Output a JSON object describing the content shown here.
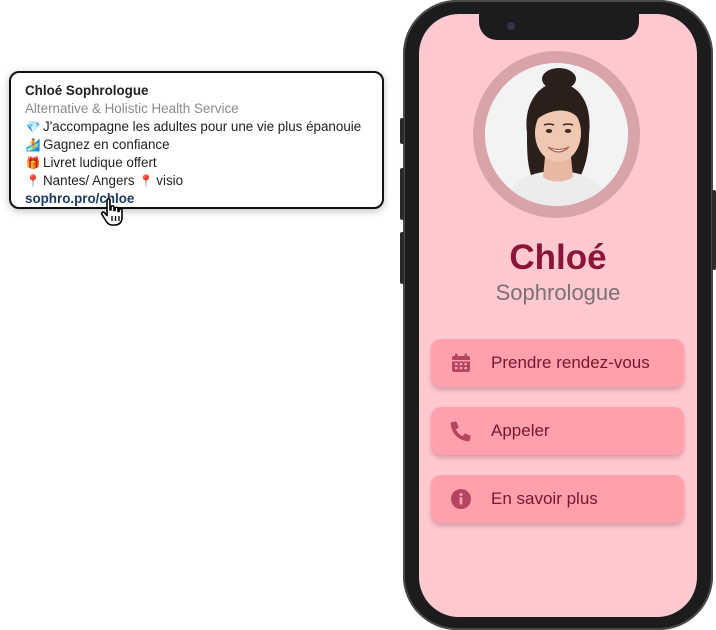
{
  "bio": {
    "name": "Chloé Sophrologue",
    "category": "Alternative & Holistic Health Service",
    "lines": [
      {
        "icon": "gem-icon",
        "emoji": "💎",
        "text": "J'accompagne les adultes pour une vie plus épanouie"
      },
      {
        "icon": "skier-icon",
        "emoji": "🏄",
        "text": "Gagnez en confiance"
      },
      {
        "icon": "gift-icon",
        "emoji": "🎁",
        "text": "Livret ludique offert"
      },
      {
        "icon": "pin-icon",
        "emoji": "📍",
        "text_before": "Nantes/ Angers",
        "text_after": "visio"
      }
    ],
    "link": "sophro.pro/chloe"
  },
  "profile": {
    "name": "Chloé",
    "title": "Sophrologue"
  },
  "actions": [
    {
      "icon": "calendar-icon",
      "label": "Prendre rendez-vous"
    },
    {
      "icon": "phone-icon",
      "label": "Appeler"
    },
    {
      "icon": "info-icon",
      "label": "En savoir plus"
    }
  ],
  "colors": {
    "screen_bg": "#ffc9cf",
    "button_bg": "#ffa0ad",
    "name_color": "#8a1538",
    "link_color": "#1c3a63"
  }
}
